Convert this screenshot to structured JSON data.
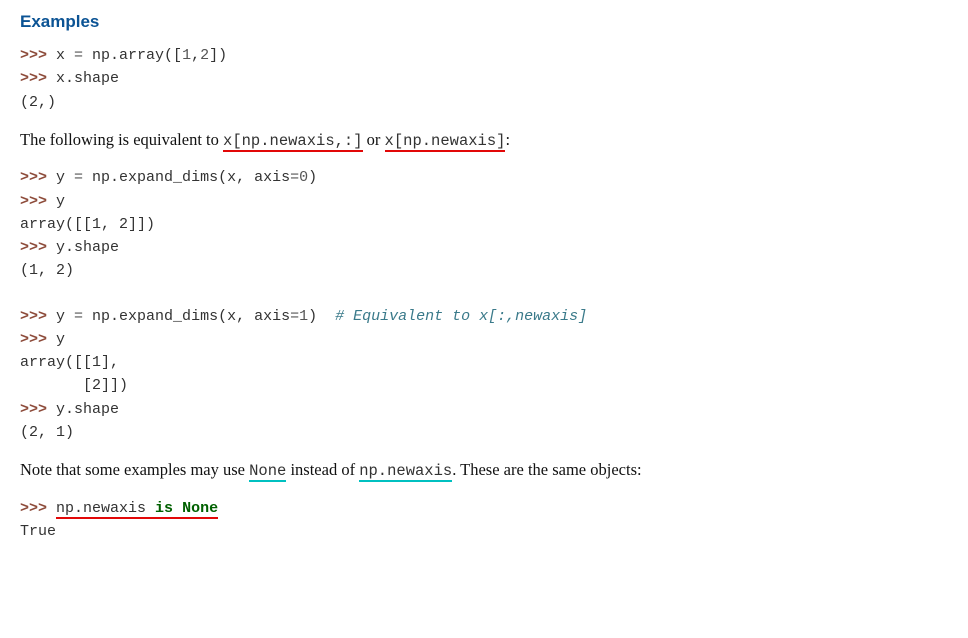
{
  "heading": "Examples",
  "block1": {
    "l1_prompt": ">>> ",
    "l1_code_a": "x ",
    "l1_code_op": "= ",
    "l1_code_b": "np.array([",
    "l1_num1": "1",
    "l1_comma": ",",
    "l1_num2": "2",
    "l1_close": "])",
    "l2_prompt": ">>> ",
    "l2_code": "x.shape",
    "l3_out": "(2,)"
  },
  "para1": {
    "a": "The following is equivalent to ",
    "code1": "x[np.newaxis,:]",
    "b": " or ",
    "code2": "x[np.newaxis]",
    "c": ":"
  },
  "block2": {
    "l1_prompt": ">>> ",
    "l1_a": "y ",
    "l1_op": "= ",
    "l1_b": "np.expand_dims(x, axis",
    "l1_eq": "=",
    "l1_num": "0",
    "l1_close": ")",
    "l2_prompt": ">>> ",
    "l2_a": "y",
    "l3_out": "array([[1, 2]])",
    "l4_prompt": ">>> ",
    "l4_a": "y.shape",
    "l5_out": "(1, 2)"
  },
  "block3": {
    "l1_prompt": ">>> ",
    "l1_a": "y ",
    "l1_op": "= ",
    "l1_b": "np.expand_dims(x, axis",
    "l1_eq": "=",
    "l1_num": "1",
    "l1_close": ")  ",
    "l1_comment": "# Equivalent to x[:,newaxis]",
    "l2_prompt": ">>> ",
    "l2_a": "y",
    "l3_out": "array([[1],",
    "l4_out": "       [2]])",
    "l5_prompt": ">>> ",
    "l5_a": "y.shape",
    "l6_out": "(2, 1)"
  },
  "para2": {
    "a": "Note that some examples may use ",
    "code1": "None",
    "b": " instead of ",
    "code2": "np.newaxis",
    "c": ". These are the same objects:"
  },
  "block4": {
    "l1_prompt": ">>> ",
    "l1_a": "np.newaxis ",
    "l1_kw": "is",
    "l1_sp": " ",
    "l1_kc": "None",
    "l2_out": "True"
  }
}
